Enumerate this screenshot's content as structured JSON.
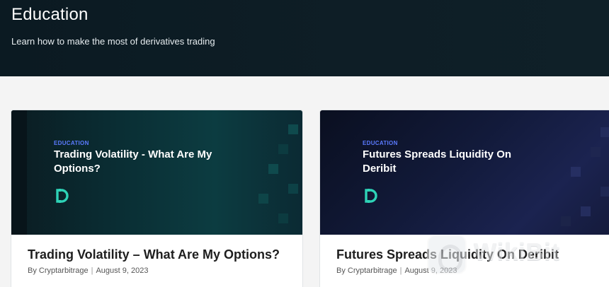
{
  "header": {
    "title": "Education",
    "subtitle": "Learn how to make the most of derivatives trading"
  },
  "cards": [
    {
      "thumb_tag": "EDUCATION",
      "thumb_title": "Trading Volatility - What Are My Options?",
      "title": "Trading Volatility – What Are My Options?",
      "author": "By Cryptarbitrage",
      "date": "August 9, 2023"
    },
    {
      "thumb_tag": "EDUCATION",
      "thumb_title": "Futures Spreads Liquidity On Deribit",
      "title": "Futures Spreads Liquidity On Deribit",
      "author": "By Cryptarbitrage",
      "date": "August 9, 2023"
    }
  ],
  "watermark": {
    "text": "WikiBit"
  },
  "colors": {
    "hero_bg": "#0e1e26",
    "tag_blue": "#5b7bff",
    "logo_teal": "#2ed3b7"
  }
}
